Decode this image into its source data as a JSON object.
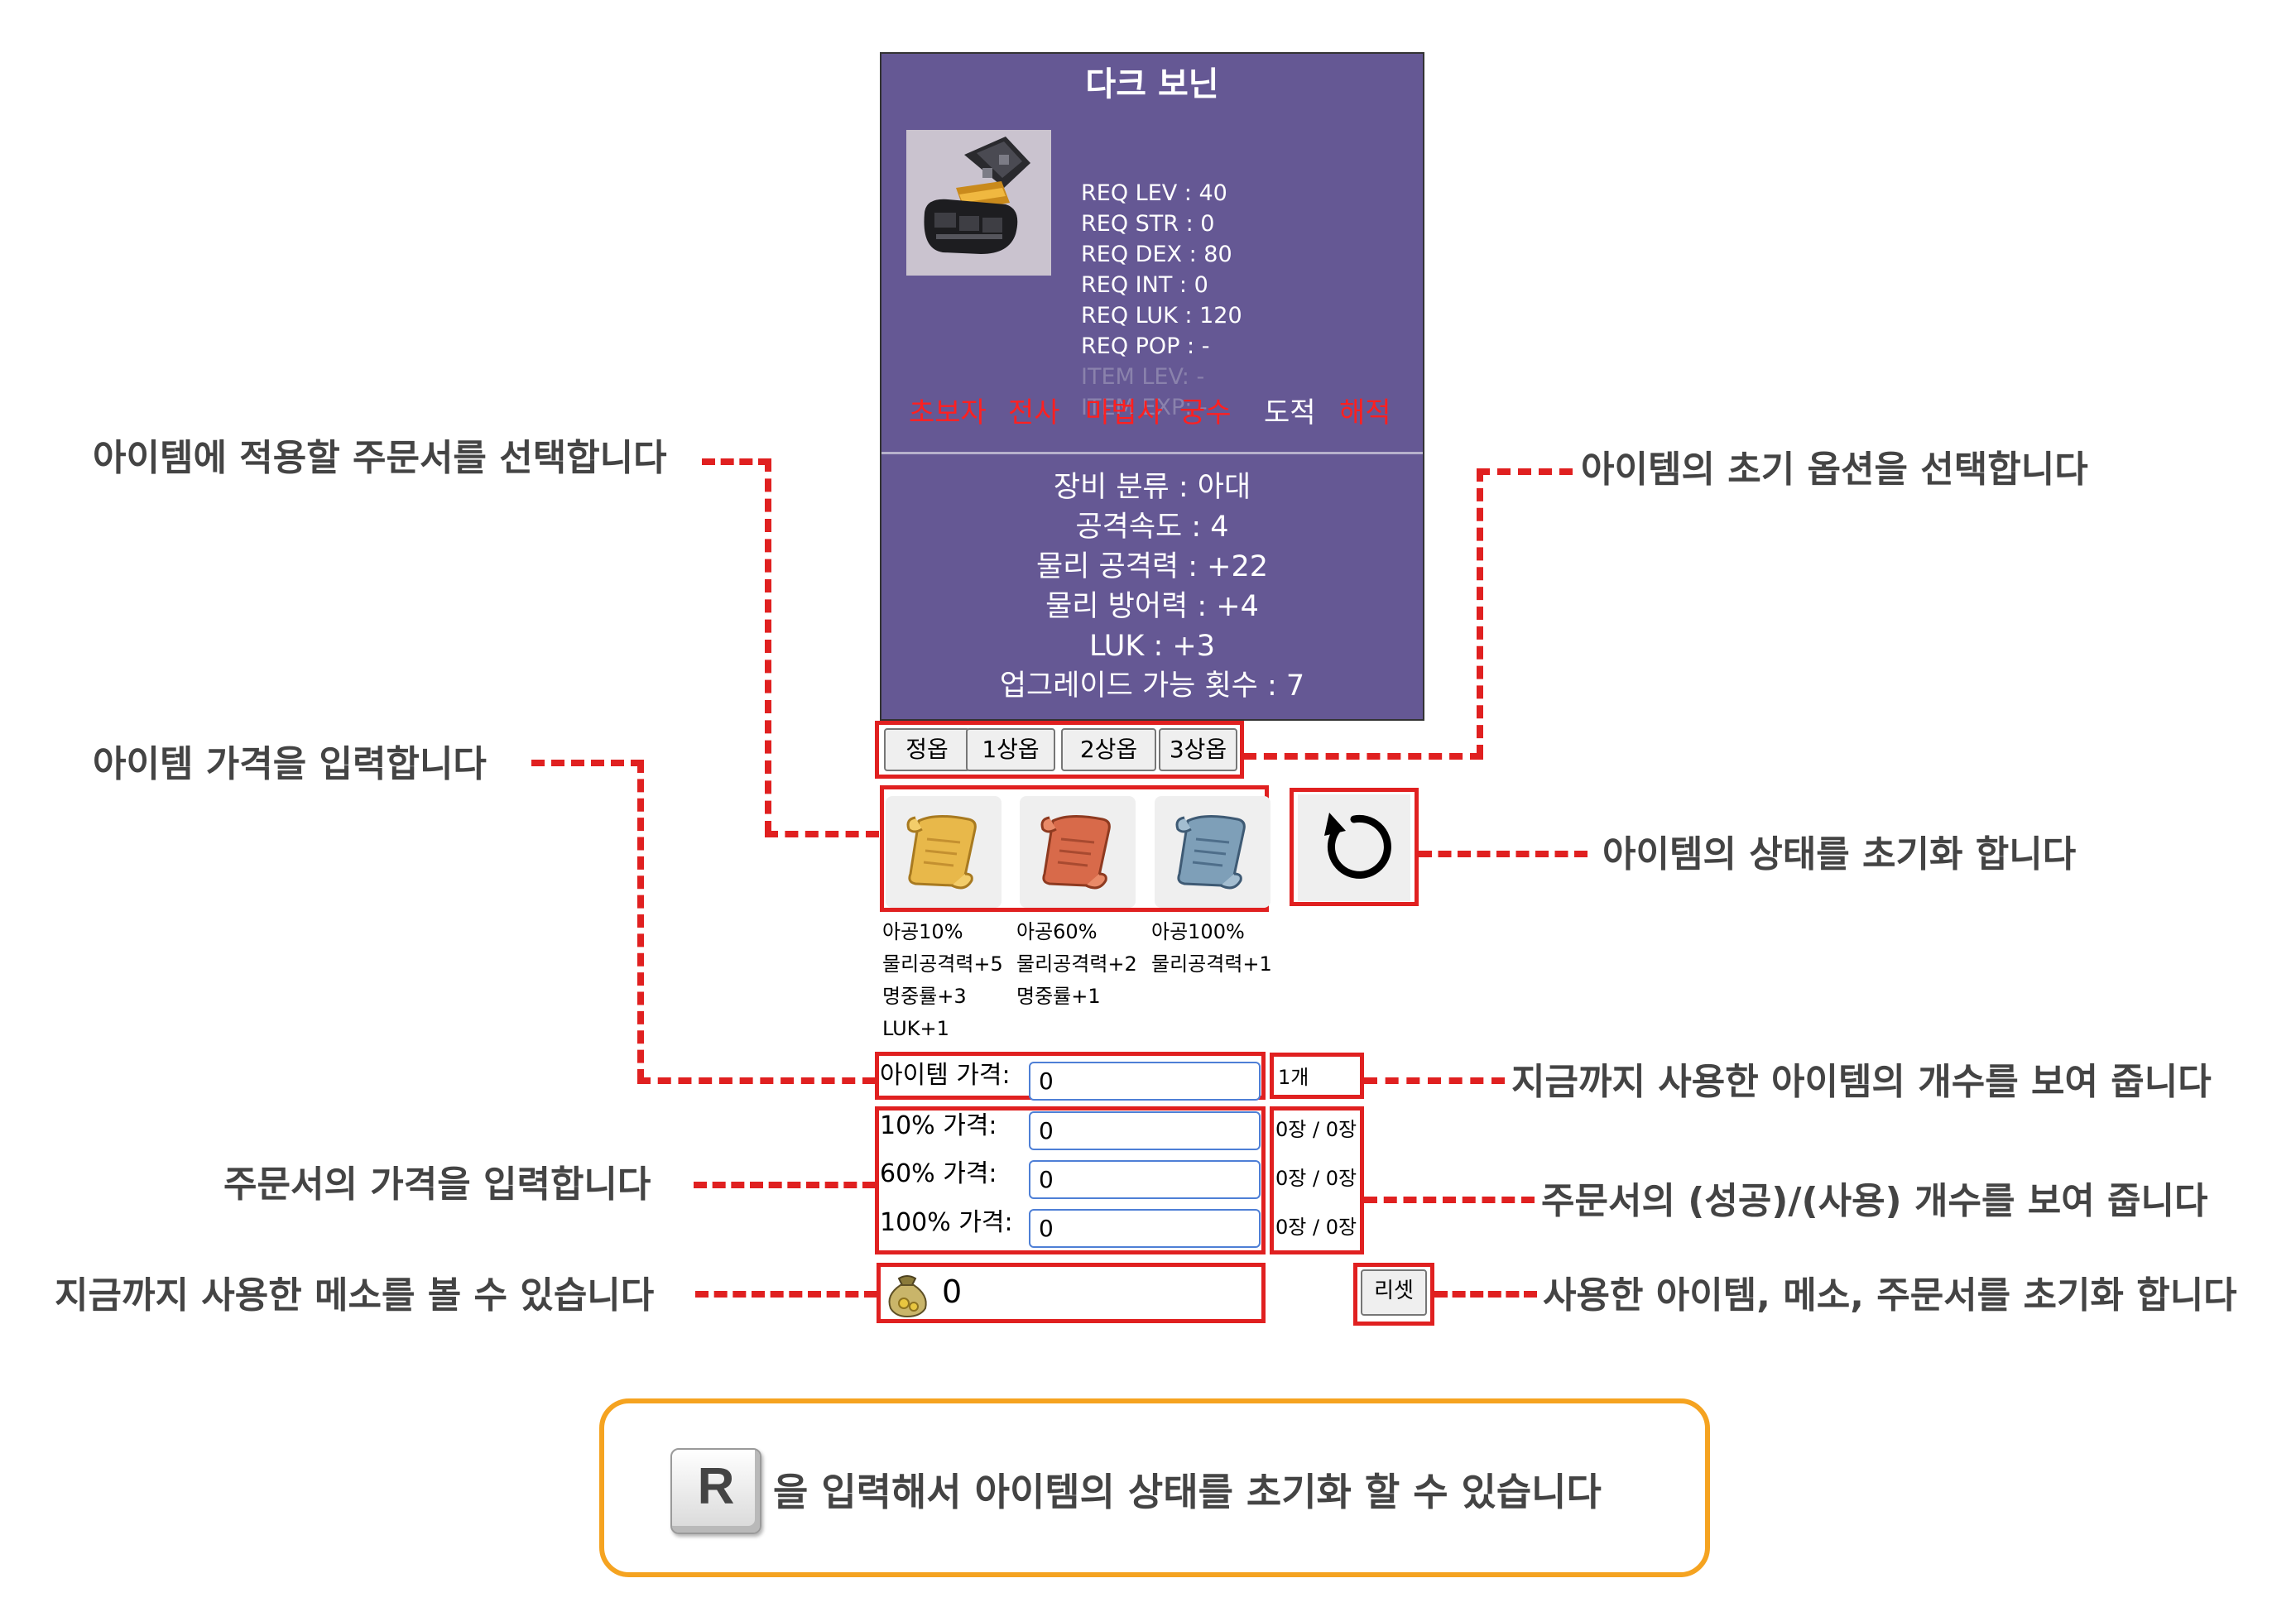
{
  "item": {
    "name": "다크 보닌",
    "icon": "dark-gauntlet-icon",
    "requirements": [
      "REQ LEV : 40",
      "REQ STR : 0",
      "REQ DEX : 80",
      "REQ INT : 0",
      "REQ LUK : 120",
      "REQ POP : -"
    ],
    "item_levels": [
      "ITEM LEV: -",
      "ITEM EXP: -"
    ],
    "jobs": [
      {
        "label": "초보자",
        "allowed": false
      },
      {
        "label": "전사",
        "allowed": false
      },
      {
        "label": "마법사",
        "allowed": false
      },
      {
        "label": "궁수",
        "allowed": false
      },
      {
        "label": "도적",
        "allowed": true
      },
      {
        "label": "해적",
        "allowed": false
      }
    ],
    "stats": [
      "장비 분류 : 아대",
      "공격속도 : 4",
      "물리 공격력 : +22",
      "물리 방어력 : +4",
      "LUK : +3",
      "업그레이드 가능 횟수 : 7"
    ]
  },
  "option_buttons": [
    "정옵",
    "1상옵",
    "2상옵",
    "3상옵"
  ],
  "scrolls": [
    {
      "icon": "yellow-scroll-icon",
      "lines": [
        "아공10%",
        "물리공격력+5",
        "명중률+3",
        "LUK+1"
      ]
    },
    {
      "icon": "red-scroll-icon",
      "lines": [
        "아공60%",
        "물리공격력+2",
        "명중률+1"
      ]
    },
    {
      "icon": "blue-scroll-icon",
      "lines": [
        "아공100%",
        "물리공격력+1"
      ]
    }
  ],
  "reset_icon": "refresh-icon",
  "prices": {
    "item_label": "아이템 가격:",
    "item_value": "0",
    "item_count": "1개",
    "scroll_rows": [
      {
        "label": "10% 가격:",
        "value": "0",
        "count": "0장 / 0장"
      },
      {
        "label": "60% 가격:",
        "value": "0",
        "count": "0장 / 0장"
      },
      {
        "label": "100% 가격:",
        "value": "0",
        "count": "0장 / 0장"
      }
    ]
  },
  "meso": {
    "icon": "meso-bag-icon",
    "value": "0"
  },
  "reset_button": "리셋",
  "annotations": {
    "select_scroll": "아이템에 적용할 주문서를 선택합니다",
    "enter_item_price": "아이템 가격을 입력합니다",
    "enter_scroll_price": "주문서의 가격을 입력합니다",
    "meso_used": "지금까지 사용한 메소를 볼 수 있습니다",
    "select_initial_option": "아이템의 초기 옵션을 선택합니다",
    "reset_item_state": "아이템의 상태를 초기화 합니다",
    "item_count_used": "지금까지 사용한 아이템의 개수를 보여 줍니다",
    "scroll_counts": "주문서의 (성공)/(사용) 개수를 보여 줍니다",
    "reset_all": "사용한 아이템, 메소, 주문서를 초기화 합니다"
  },
  "tip": {
    "key": "R",
    "text": "을 입력해서 아이템의 상태를 초기화 할 수 있습니다"
  },
  "colors": {
    "card_bg": "#655894",
    "frame_red": "#e02020",
    "tip_border": "#f5a320",
    "job_disabled": "#ff2020"
  }
}
